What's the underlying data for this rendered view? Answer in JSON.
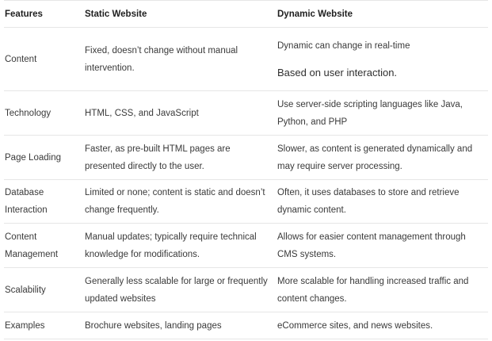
{
  "headers": [
    "Features",
    "Static Website",
    "Dynamic Website"
  ],
  "rows": [
    {
      "feature": "Content",
      "static": "Fixed, doesn’t change without manual intervention.",
      "dynamic": "Dynamic can change in real-time",
      "dynamic_extra": "Based on user interaction."
    },
    {
      "feature": "Technology",
      "static": "HTML, CSS, and JavaScript",
      "dynamic": "Use server-side scripting languages like Java, Python, and PHP"
    },
    {
      "feature": "Page Loading",
      "static": "Faster, as pre-built HTML pages are presented directly to the user.",
      "dynamic": "Slower, as content is generated dynamically and may require server processing."
    },
    {
      "feature": "Database Interaction",
      "static": "Limited or none; content is static and doesn’t change frequently.",
      "dynamic": "Often, it uses databases to store and retrieve dynamic content."
    },
    {
      "feature": "Content Management",
      "static": "Manual updates; typically require technical knowledge for modifications.",
      "dynamic": "Allows for easier content management through CMS systems."
    },
    {
      "feature": "Scalability",
      "static": "Generally less scalable for large or frequently updated websites",
      "dynamic": "More scalable for handling increased traffic and content changes."
    },
    {
      "feature": "Examples",
      "static": "Brochure websites, landing pages",
      "dynamic": "eCommerce sites, and news websites."
    }
  ]
}
